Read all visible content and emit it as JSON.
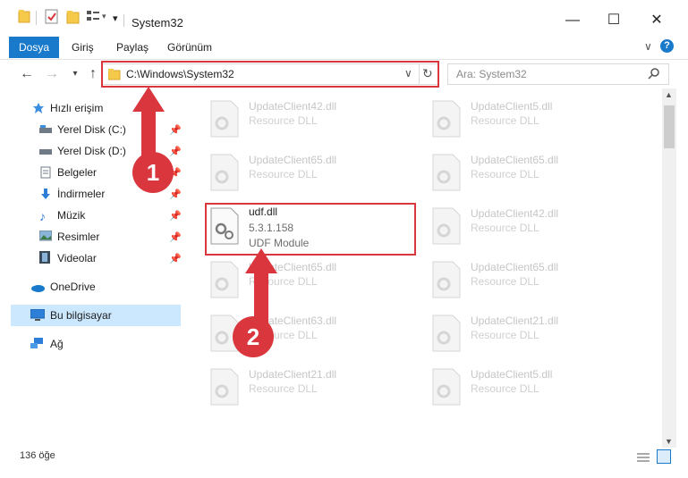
{
  "window": {
    "title": "System32"
  },
  "ribbon": {
    "tabs": [
      "Dosya",
      "Giriş",
      "Paylaş",
      "Görünüm"
    ]
  },
  "address": {
    "path": "C:\\Windows\\System32",
    "search_placeholder": "Ara: System32"
  },
  "sidebar": {
    "items": [
      {
        "label": "Hızlı erişim",
        "icon": "star-icon"
      },
      {
        "label": "Yerel Disk (C:)",
        "icon": "drive-icon"
      },
      {
        "label": "Yerel Disk (D:)",
        "icon": "drive-icon"
      },
      {
        "label": "Belgeler",
        "icon": "documents-icon"
      },
      {
        "label": "İndirmeler",
        "icon": "download-icon"
      },
      {
        "label": "Müzik",
        "icon": "music-icon"
      },
      {
        "label": "Resimler",
        "icon": "pictures-icon"
      },
      {
        "label": "Videolar",
        "icon": "video-icon"
      },
      {
        "label": "OneDrive",
        "icon": "cloud-icon"
      },
      {
        "label": "Bu bilgisayar",
        "icon": "computer-icon"
      },
      {
        "label": "Ağ",
        "icon": "network-icon"
      }
    ]
  },
  "files": {
    "left": [
      {
        "name": "UpdateClient42.dll",
        "type": "Resource DLL"
      },
      {
        "name": "UpdateClient65.dll",
        "type": "Resource DLL"
      },
      {
        "name": "udf.dll",
        "version": "5.3.1.158",
        "type": "UDF Module"
      },
      {
        "name": "UpdateClient65.dll",
        "type": "Resource DLL"
      },
      {
        "name": "UpdateClient63.dll",
        "type": "Resource DLL"
      },
      {
        "name": "UpdateClient21.dll",
        "type": "Resource DLL"
      }
    ],
    "right": [
      {
        "name": "UpdateClient5.dll",
        "type": "Resource DLL"
      },
      {
        "name": "UpdateClient65.dll",
        "type": "Resource DLL"
      },
      {
        "name": "UpdateClient42.dll",
        "type": "Resource DLL"
      },
      {
        "name": "UpdateClient65.dll",
        "type": "Resource DLL"
      },
      {
        "name": "UpdateClient21.dll",
        "type": "Resource DLL"
      },
      {
        "name": "UpdateClient5.dll",
        "type": "Resource DLL"
      }
    ]
  },
  "status": {
    "count": "136 öğe"
  },
  "annotations": {
    "badge1": "1",
    "badge2": "2"
  },
  "colors": {
    "accent": "#1979ca",
    "highlight": "#d9363e",
    "selected": "#cce8ff"
  }
}
